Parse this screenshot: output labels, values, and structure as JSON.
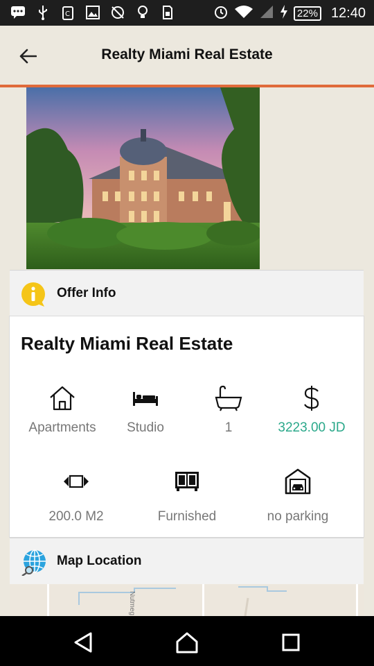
{
  "status_bar": {
    "battery": "22%",
    "time": "12:40",
    "icons": [
      "chat-icon",
      "usb-icon",
      "clipboard-icon",
      "image-icon",
      "sync-off-icon",
      "bulb-icon",
      "sim-icon",
      "alarm-icon",
      "wifi-icon",
      "signal-icon",
      "charging-icon"
    ]
  },
  "app_bar": {
    "title": "Realty Miami Real Estate"
  },
  "offer_info": {
    "header": "Offer Info",
    "title": "Realty Miami Real Estate",
    "features_row1": [
      {
        "icon": "house-icon",
        "label": "Apartments"
      },
      {
        "icon": "bed-icon",
        "label": "Studio"
      },
      {
        "icon": "bathtub-icon",
        "label": "1"
      },
      {
        "icon": "dollar-icon",
        "label": "3223.00 JD"
      }
    ],
    "features_row2": [
      {
        "icon": "area-icon",
        "label": "200.0 M2"
      },
      {
        "icon": "wardrobe-icon",
        "label": "Furnished"
      },
      {
        "icon": "garage-icon",
        "label": "no parking"
      }
    ]
  },
  "map_location": {
    "header": "Map Location",
    "map_label": "Nutmeg"
  },
  "colors": {
    "accent": "#E06A3A",
    "price": "#2AA88A",
    "background": "#ECE8DE"
  }
}
